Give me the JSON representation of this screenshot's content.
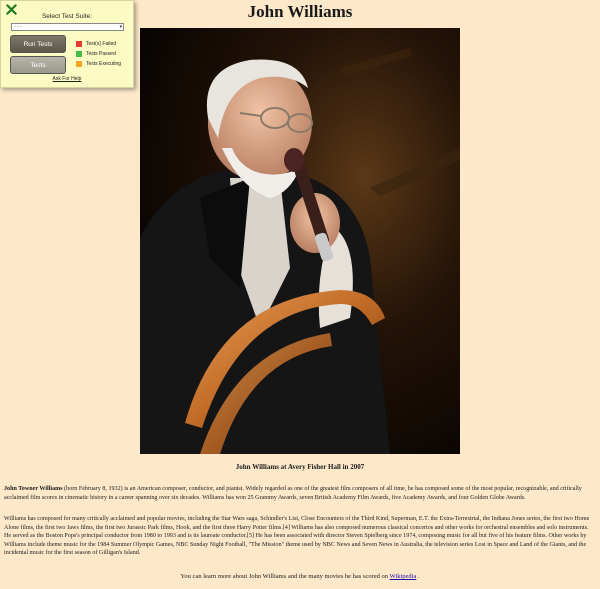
{
  "page": {
    "title": "John Williams",
    "photo_alt": "John Williams at Avery Fisher Hall in 2007",
    "caption": "John Williams at Avery Fisher Hall in 2007",
    "p1_name": "John Towner Williams",
    "p1_rest": " (born February 8, 1932) is an American composer, conductor, and pianist. Widely regarded as one of the greatest film composers of all time, he has composed some of the most popular, recognizable, and critically acclaimed film scores in cinematic history in a career spanning over six decades. Williams has won 25 Grammy Awards, seven British Academy Film Awards, five Academy Awards, and four Golden Globe Awards.",
    "p2": "Williams has composed for many critically acclaimed and popular movies, including the Star Wars saga, Schindler's List, Close Encounters of the Third Kind, Superman, E.T. the Extra-Terrestrial, the Indiana Jones series, the first two Home Alone films, the first two Jaws films, the first two Jurassic Park films, Hook, and the first three Harry Potter films.[4] Williams has also composed numerous classical concertos and other works for orchestral ensembles and solo instruments. He served as the Boston Pops's principal conductor from 1980 to 1993 and is its laureate conductor.[5] He has been associated with director Steven Spielberg since 1974, composing music for all but five of his feature films. Other works by Williams include theme music for the 1984 Summer Olympic Games, NBC Sunday Night Football, \"The Mission\" theme used by NBC News and Seven News in Australia, the television series Lost in Space and Land of the Giants, and the incidental music for the first season of Gilligan's Island.",
    "footer_prefix": "You can learn more about John Williams and the many movies he has scored on ",
    "footer_link": "Wikipedia",
    "footer_suffix": " ."
  },
  "test_panel": {
    "title": "Select Test Suite:",
    "select_value": "- - -",
    "run_button": "Run Tests",
    "tests_button": "Tests",
    "legend": [
      {
        "label": "Test(s) Failed",
        "color": "#e53935"
      },
      {
        "label": "Tests Passed",
        "color": "#43c043"
      },
      {
        "label": "Tests Executing",
        "color": "#f5a623"
      }
    ],
    "help_link": "Ask For Help",
    "close_icon_color": "#1e7a1e"
  }
}
